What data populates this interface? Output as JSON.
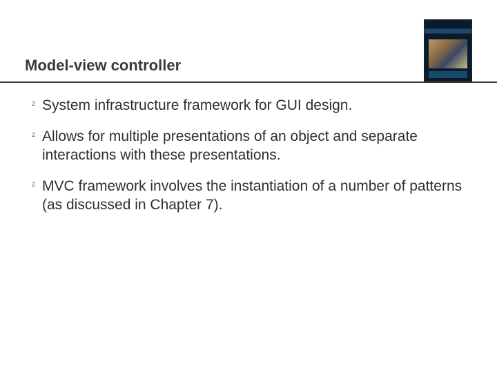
{
  "slide": {
    "title": "Model-view controller",
    "bullets": [
      "System infrastructure framework for GUI design.",
      "Allows for multiple presentations of an object and separate interactions with these presentations.",
      "MVC framework involves the instantiation of a number of patterns (as discussed in Chapter 7)."
    ],
    "bullet_glyph": "²"
  }
}
